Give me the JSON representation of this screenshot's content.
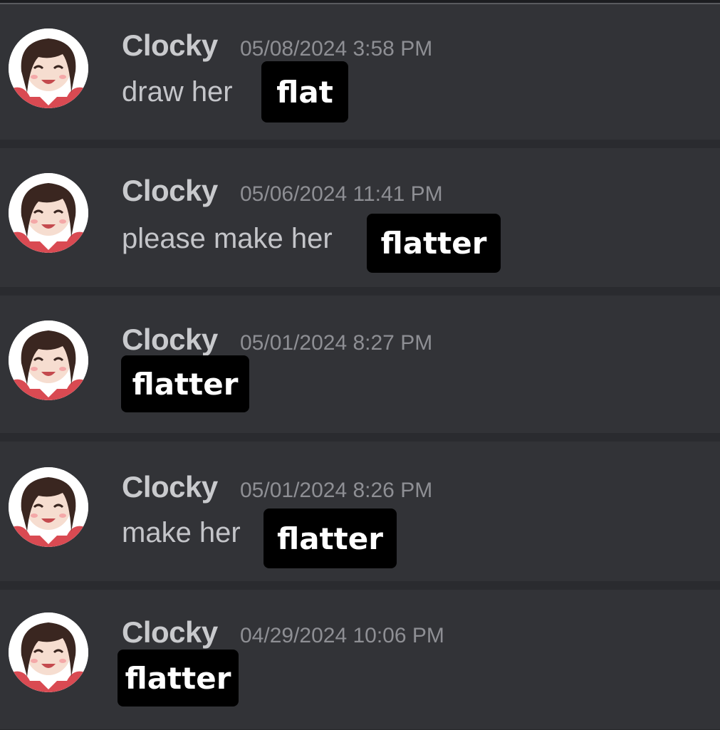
{
  "messages": [
    {
      "author": "Clocky",
      "timestamp": "05/08/2024 3:58 PM",
      "text": "draw her",
      "highlight": "flat"
    },
    {
      "author": "Clocky",
      "timestamp": "05/06/2024 11:41 PM",
      "text": "please make her",
      "highlight": "flatter"
    },
    {
      "author": "Clocky",
      "timestamp": "05/01/2024 8:27 PM",
      "text": "",
      "highlight": "flatter"
    },
    {
      "author": "Clocky",
      "timestamp": "05/01/2024 8:26 PM",
      "text": "make her",
      "highlight": "flatter"
    },
    {
      "author": "Clocky",
      "timestamp": "04/29/2024 10:06 PM",
      "text": "",
      "highlight": "flatter"
    }
  ],
  "colors": {
    "background": "#2d2e32",
    "username": "#c9cacd",
    "timestamp": "#8e8f94",
    "message_text": "#c4c5c9",
    "highlight_bg": "#000000",
    "highlight_text": "#ffffff"
  },
  "icons": {
    "avatar": "anime-girl-avatar-icon"
  }
}
